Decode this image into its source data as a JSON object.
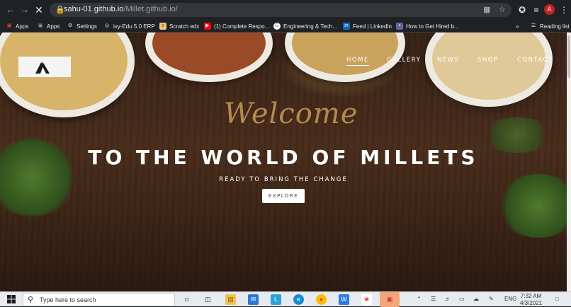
{
  "browser": {
    "url_host": "sahu-01.github.io",
    "url_path": "/Millet.github.io/",
    "profile_initial": "A"
  },
  "bookmarks": [
    {
      "label": "Apps",
      "icon": "apps-grid-icon",
      "color": "#ea4335"
    },
    {
      "label": "Apps",
      "icon": "apps-grid-icon",
      "color": "#9aa0a6"
    },
    {
      "label": "Settings",
      "icon": "gear-icon",
      "color": "#e8eaed"
    },
    {
      "label": "ivy-Edu 5.0 ERP",
      "icon": "globe-icon",
      "color": "#e8eaed"
    },
    {
      "label": "Scratch edx",
      "icon": "scratch-icon",
      "color": "#f0c27b"
    },
    {
      "label": "(1) Complete Respo...",
      "icon": "youtube-icon",
      "color": "#ff0000"
    },
    {
      "label": "Engineering & Tech...",
      "icon": "google-icon",
      "color": "#4285f4"
    },
    {
      "label": "Feed | LinkedIn",
      "icon": "linkedin-icon",
      "color": "#0a66c2"
    },
    {
      "label": "How to Get Hired b...",
      "icon": "page-icon",
      "color": "#5f6a9a"
    }
  ],
  "reading_list": "Reading list",
  "site": {
    "nav": [
      "HOME",
      "GALLERY",
      "NEWS",
      "SHOP",
      "CONTACT"
    ],
    "welcome": "Welcome",
    "headline": "TO THE WORLD OF MILLETS",
    "subheading": "READY TO BRING THE CHANGE",
    "cta": "EXPLORE"
  },
  "taskbar": {
    "search_placeholder": "Type here to search",
    "language": "ENG",
    "time": "7:32 AM",
    "date": "4/3/2021"
  },
  "colors": {
    "accent_gold": "#b38a4f",
    "chrome_bg": "#202124",
    "taskbar_bg": "#e7eaee"
  }
}
